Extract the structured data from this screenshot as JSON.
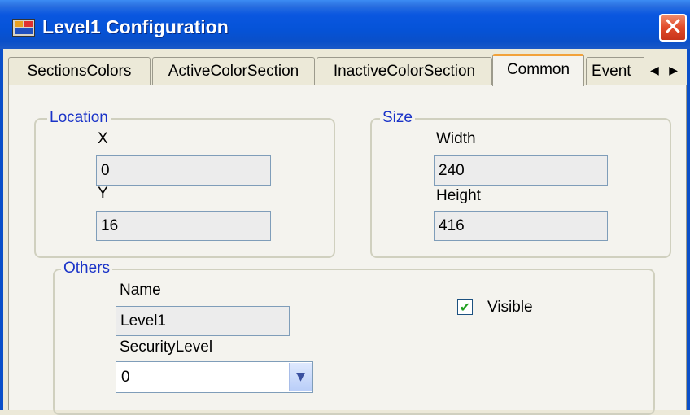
{
  "window": {
    "title": "Level1 Configuration",
    "close_glyph": "✕"
  },
  "tabs": [
    {
      "label": "SectionsColors"
    },
    {
      "label": "ActiveColorSection"
    },
    {
      "label": "InactiveColorSection"
    },
    {
      "label": "Common",
      "active": true
    },
    {
      "label": "Event"
    }
  ],
  "tab_scroll": {
    "left": "◀",
    "right": "▶"
  },
  "location": {
    "legend": "Location",
    "x_label": "X",
    "x_value": "0",
    "y_label": "Y",
    "y_value": "16"
  },
  "size": {
    "legend": "Size",
    "width_label": "Width",
    "width_value": "240",
    "height_label": "Height",
    "height_value": "416"
  },
  "others": {
    "legend": "Others",
    "name_label": "Name",
    "name_value": "Level1",
    "security_label": "SecurityLevel",
    "security_value": "0",
    "visible_label": "Visible",
    "visible_checked": true,
    "check_glyph": "✔",
    "dropdown_glyph": "▼"
  }
}
